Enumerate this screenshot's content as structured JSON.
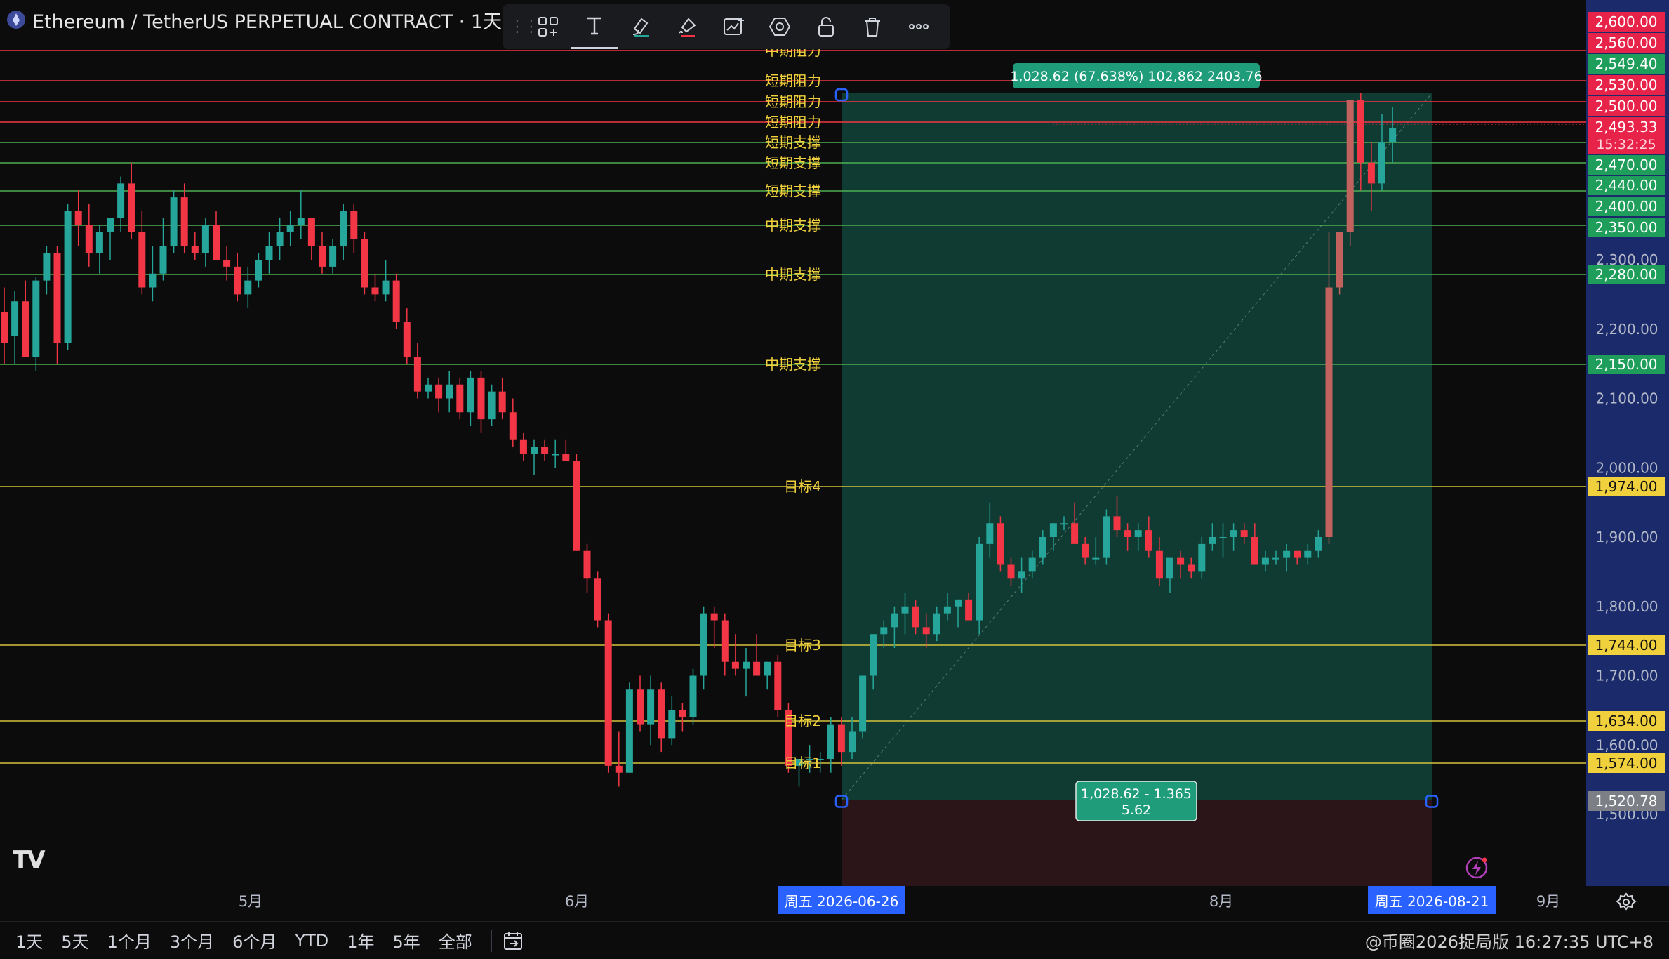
{
  "header": {
    "title": "Ethereum / TetherUS PERPETUAL CONTRACT · 1天 · Bi"
  },
  "toolbar": {
    "icons": [
      "layout-icon",
      "text-icon",
      "brush-icon",
      "paint-icon",
      "chart-plus-icon",
      "hexagon-icon",
      "lock-icon",
      "trash-icon",
      "more-icon"
    ],
    "text_tool_label": "T"
  },
  "measure": {
    "top_label": "1,028.62 (67.638%) 102,862 2403.76",
    "bottom_line1": "1,028.62 - 1.365",
    "bottom_line2": "5.62"
  },
  "time_axis": {
    "labels": [
      "5月",
      "6月",
      "8月",
      "9月"
    ],
    "highlight_start": "周五 2026-06-26",
    "highlight_end": "周五 2026-08-21"
  },
  "price_axis": {
    "ticks": [
      "2,300.00",
      "2,200.00",
      "2,100.00",
      "2,000.00",
      "1,900.00",
      "1,800.00",
      "1,700.00",
      "1,600.00",
      "1,500.00"
    ],
    "last_price": "2,493.33",
    "countdown": "15:32:25",
    "marker_2549": "2,549.40",
    "marker_1520": "1,520.78",
    "line_labels": [
      "2,600.00",
      "2,560.00",
      "2,530.00",
      "2,500.00",
      "2,470.00",
      "2,440.00",
      "2,400.00",
      "2,350.00",
      "2,280.00",
      "2,150.00",
      "1,974.00",
      "1,744.00",
      "1,634.00",
      "1,574.00"
    ]
  },
  "levels": [
    {
      "name": "中期阻力",
      "price": 2560,
      "kind": "resistance"
    },
    {
      "name": "短期阻力",
      "price": 2530,
      "kind": "resistance"
    },
    {
      "name": "短期阻力",
      "price": 2500,
      "kind": "resistance"
    },
    {
      "name": "短期阻力",
      "price": 2470,
      "kind": "resistance"
    },
    {
      "name": "短期支撑",
      "price": 2440,
      "kind": "support"
    },
    {
      "name": "短期支撑",
      "price": 2410,
      "kind": "support"
    },
    {
      "name": "短期支撑",
      "price": 2370,
      "kind": "support"
    },
    {
      "name": "中期支撑",
      "price": 2320,
      "kind": "support"
    },
    {
      "name": "中期支撑",
      "price": 2250,
      "kind": "support"
    },
    {
      "name": "中期支撑",
      "price": 2120,
      "kind": "support"
    },
    {
      "name": "目标4",
      "price": 1942,
      "kind": "target"
    },
    {
      "name": "目标3",
      "price": 1712,
      "kind": "target"
    },
    {
      "name": "目标2",
      "price": 1602,
      "kind": "target"
    },
    {
      "name": "目标1",
      "price": 1542,
      "kind": "target"
    }
  ],
  "colors": {
    "up": "#26a69a",
    "down": "#f23645",
    "resistance": "#f23645",
    "support": "#4caf50",
    "target": "#d4c23a",
    "label_text": "#f0d03c",
    "measure_fill": "#0f3b32",
    "measure_loss": "#2b1518",
    "axis_bg": "#1a2a6b",
    "badge_green": "#1f9d5a",
    "badge_red": "#e8234a",
    "badge_yellow": "#f0d03c",
    "crosshair_blue": "#2962ff"
  },
  "bottom": {
    "ranges": [
      "1天",
      "5天",
      "1个月",
      "3个月",
      "6个月",
      "YTD",
      "1年",
      "5年",
      "全部"
    ],
    "watermark": "@币圈2026捉局版",
    "clock": "16:27:35 UTC+8"
  },
  "chart_data": {
    "type": "candlestick",
    "y_scale": "linear",
    "y_range": [
      1450,
      2625
    ],
    "candles": [
      [
        2225,
        2260,
        2150,
        2180
      ],
      [
        2190,
        2255,
        2150,
        2240
      ],
      [
        2240,
        2270,
        2175,
        2160
      ],
      [
        2160,
        2275,
        2140,
        2270
      ],
      [
        2270,
        2320,
        2250,
        2310
      ],
      [
        2310,
        2320,
        2150,
        2180
      ],
      [
        2180,
        2380,
        2170,
        2370
      ],
      [
        2370,
        2400,
        2320,
        2350
      ],
      [
        2350,
        2380,
        2290,
        2310
      ],
      [
        2310,
        2350,
        2280,
        2340
      ],
      [
        2340,
        2360,
        2300,
        2360
      ],
      [
        2360,
        2420,
        2340,
        2410
      ],
      [
        2410,
        2440,
        2330,
        2340
      ],
      [
        2340,
        2370,
        2250,
        2260
      ],
      [
        2260,
        2320,
        2240,
        2280
      ],
      [
        2280,
        2360,
        2270,
        2320
      ],
      [
        2320,
        2400,
        2310,
        2390
      ],
      [
        2390,
        2410,
        2310,
        2320
      ],
      [
        2320,
        2340,
        2300,
        2310
      ],
      [
        2310,
        2360,
        2290,
        2350
      ],
      [
        2350,
        2370,
        2300,
        2300
      ],
      [
        2300,
        2320,
        2270,
        2290
      ],
      [
        2290,
        2310,
        2240,
        2250
      ],
      [
        2250,
        2290,
        2230,
        2270
      ],
      [
        2270,
        2310,
        2260,
        2300
      ],
      [
        2300,
        2340,
        2280,
        2320
      ],
      [
        2320,
        2360,
        2300,
        2340
      ],
      [
        2340,
        2370,
        2320,
        2350
      ],
      [
        2350,
        2400,
        2330,
        2360
      ],
      [
        2360,
        2360,
        2300,
        2320
      ],
      [
        2320,
        2340,
        2280,
        2290
      ],
      [
        2290,
        2330,
        2280,
        2320
      ],
      [
        2320,
        2380,
        2300,
        2370
      ],
      [
        2370,
        2380,
        2310,
        2330
      ],
      [
        2330,
        2340,
        2250,
        2260
      ],
      [
        2260,
        2280,
        2240,
        2250
      ],
      [
        2250,
        2300,
        2240,
        2270
      ],
      [
        2270,
        2280,
        2200,
        2210
      ],
      [
        2210,
        2230,
        2150,
        2160
      ],
      [
        2160,
        2180,
        2100,
        2110
      ],
      [
        2110,
        2130,
        2100,
        2120
      ],
      [
        2120,
        2130,
        2080,
        2100
      ],
      [
        2100,
        2140,
        2080,
        2120
      ],
      [
        2120,
        2130,
        2070,
        2080
      ],
      [
        2080,
        2140,
        2060,
        2130
      ],
      [
        2130,
        2140,
        2050,
        2070
      ],
      [
        2070,
        2120,
        2060,
        2110
      ],
      [
        2110,
        2130,
        2070,
        2080
      ],
      [
        2080,
        2100,
        2030,
        2040
      ],
      [
        2040,
        2050,
        2010,
        2020
      ],
      [
        2020,
        2040,
        1990,
        2030
      ],
      [
        2030,
        2040,
        2010,
        2020
      ],
      [
        2020,
        2040,
        2000,
        2020
      ],
      [
        2020,
        2040,
        2010,
        2010
      ],
      [
        2010,
        2020,
        1880,
        1880
      ],
      [
        1880,
        1890,
        1820,
        1840
      ],
      [
        1840,
        1850,
        1770,
        1780
      ],
      [
        1780,
        1790,
        1560,
        1570
      ],
      [
        1570,
        1620,
        1540,
        1560
      ],
      [
        1560,
        1690,
        1560,
        1680
      ],
      [
        1680,
        1700,
        1620,
        1630
      ],
      [
        1630,
        1700,
        1600,
        1680
      ],
      [
        1680,
        1690,
        1590,
        1610
      ],
      [
        1610,
        1670,
        1600,
        1650
      ],
      [
        1650,
        1660,
        1620,
        1640
      ],
      [
        1640,
        1710,
        1630,
        1700
      ],
      [
        1700,
        1800,
        1680,
        1790
      ],
      [
        1790,
        1800,
        1740,
        1780
      ],
      [
        1780,
        1790,
        1700,
        1720
      ],
      [
        1720,
        1760,
        1700,
        1710
      ],
      [
        1710,
        1740,
        1670,
        1720
      ],
      [
        1720,
        1760,
        1700,
        1700
      ],
      [
        1700,
        1720,
        1680,
        1720
      ],
      [
        1720,
        1730,
        1640,
        1650
      ],
      [
        1650,
        1660,
        1560,
        1570
      ],
      [
        1570,
        1580,
        1540,
        1580
      ],
      [
        1580,
        1600,
        1560,
        1580
      ],
      [
        1580,
        1590,
        1560,
        1580
      ],
      [
        1580,
        1640,
        1560,
        1630
      ],
      [
        1630,
        1640,
        1570,
        1590
      ],
      [
        1590,
        1640,
        1580,
        1620
      ],
      [
        1620,
        1700,
        1610,
        1700
      ],
      [
        1700,
        1760,
        1680,
        1760
      ],
      [
        1760,
        1780,
        1740,
        1770
      ],
      [
        1770,
        1800,
        1740,
        1790
      ],
      [
        1790,
        1820,
        1760,
        1800
      ],
      [
        1800,
        1810,
        1760,
        1770
      ],
      [
        1770,
        1790,
        1740,
        1760
      ],
      [
        1760,
        1800,
        1750,
        1790
      ],
      [
        1790,
        1820,
        1780,
        1800
      ],
      [
        1800,
        1810,
        1770,
        1810
      ],
      [
        1810,
        1820,
        1780,
        1780
      ],
      [
        1780,
        1900,
        1760,
        1890
      ],
      [
        1890,
        1950,
        1870,
        1920
      ],
      [
        1920,
        1930,
        1850,
        1860
      ],
      [
        1860,
        1870,
        1830,
        1840
      ],
      [
        1840,
        1870,
        1820,
        1850
      ],
      [
        1850,
        1880,
        1840,
        1870
      ],
      [
        1870,
        1910,
        1860,
        1900
      ],
      [
        1900,
        1920,
        1880,
        1920
      ],
      [
        1920,
        1930,
        1910,
        1920
      ],
      [
        1920,
        1950,
        1890,
        1890
      ],
      [
        1890,
        1900,
        1860,
        1870
      ],
      [
        1870,
        1900,
        1860,
        1870
      ],
      [
        1870,
        1940,
        1860,
        1930
      ],
      [
        1930,
        1960,
        1900,
        1910
      ],
      [
        1910,
        1920,
        1880,
        1900
      ],
      [
        1900,
        1920,
        1880,
        1910
      ],
      [
        1910,
        1930,
        1870,
        1880
      ],
      [
        1880,
        1900,
        1830,
        1840
      ],
      [
        1840,
        1870,
        1820,
        1870
      ],
      [
        1870,
        1880,
        1840,
        1860
      ],
      [
        1860,
        1870,
        1840,
        1850
      ],
      [
        1850,
        1900,
        1840,
        1890
      ],
      [
        1890,
        1920,
        1880,
        1900
      ],
      [
        1900,
        1920,
        1870,
        1900
      ],
      [
        1900,
        1920,
        1880,
        1910
      ],
      [
        1910,
        1920,
        1890,
        1900
      ],
      [
        1900,
        1920,
        1860,
        1860
      ],
      [
        1860,
        1880,
        1850,
        1870
      ],
      [
        1870,
        1880,
        1860,
        1870
      ],
      [
        1870,
        1890,
        1850,
        1880
      ],
      [
        1880,
        1880,
        1860,
        1870
      ],
      [
        1870,
        1890,
        1860,
        1880
      ],
      [
        1880,
        1910,
        1870,
        1900
      ],
      [
        1900,
        2340,
        1890,
        2260
      ],
      [
        2260,
        2340,
        2250,
        2340
      ],
      [
        2340,
        2530,
        2320,
        2530
      ],
      [
        2530,
        2540,
        2400,
        2440
      ],
      [
        2440,
        2470,
        2370,
        2410
      ],
      [
        2410,
        2510,
        2400,
        2470
      ],
      [
        2470,
        2520,
        2440,
        2490
      ]
    ]
  }
}
